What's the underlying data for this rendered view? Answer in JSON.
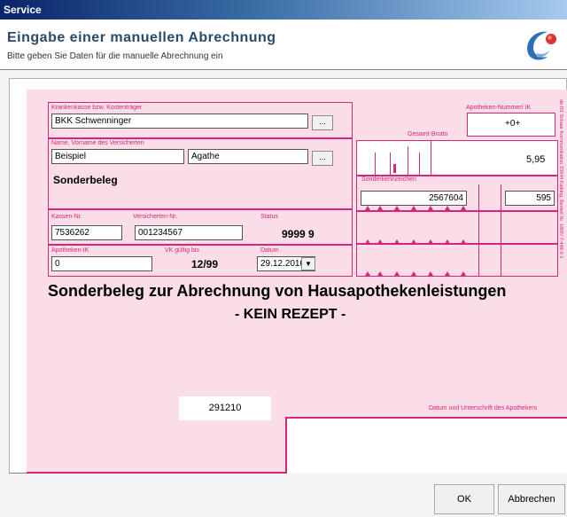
{
  "window": {
    "title": "Service"
  },
  "header": {
    "title": "Eingabe einer manuellen Abrechnung",
    "subtitle": "Bitte geben Sie Daten für die manuelle Abrechnung ein"
  },
  "form": {
    "kasse_label": "Krankenkasse bzw. Kostenträger",
    "kasse_value": "BKK Schwenninger",
    "browse_label": "...",
    "name_label": "Name, Vorname des Versicherten",
    "nachname": "Beispiel",
    "vorname": "Agathe",
    "sonderbeleg": "Sonderbeleg",
    "kassen_nr_label": "Kassen-Nr.",
    "kassen_nr": "7536262",
    "versicherten_nr_label": "Versicherten-Nr.",
    "versicherten_nr": "001234567",
    "status_label": "Status",
    "status": "9999 9",
    "apotheken_ik_label": "Apotheken-IK",
    "apotheken_ik": "0",
    "vk_label": "VK gültig bis",
    "vk": "12/99",
    "datum_label": "Datum",
    "datum": "29.12.2010",
    "apo_nummer_label": "Apotheken-Nummer/ IK",
    "apo_nummer": "+0+",
    "gesamt_brutto_label": "Gesamt-Brutto",
    "gesamt_brutto": "5,95",
    "sonderkennzeichen_label": "Sonderkennzeichen",
    "sonderkennzeichen": "2567604",
    "faktor": "595",
    "headline1": "Sonderbeleg zur Abrechnung von Hausapothekenleistungen",
    "headline2": "- KEIN REZEPT -",
    "code": "291210",
    "signature_label": "Datum und Unterschrift des Apothekers",
    "side_text": "de-R1 Schaar Kommunikation 33644 Kalbing, Bestell-Nr. 180F/ 7-448-9-1"
  },
  "footer": {
    "ok_label": "OK",
    "cancel_label": "Abbrechen"
  },
  "colors": {
    "accent": "#d4267a",
    "pink": "#fbdde7"
  }
}
